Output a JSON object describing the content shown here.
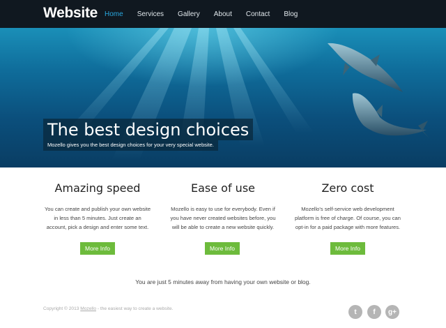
{
  "header": {
    "logo": "Website",
    "nav": [
      {
        "label": "Home",
        "active": true
      },
      {
        "label": "Services"
      },
      {
        "label": "Gallery"
      },
      {
        "label": "About"
      },
      {
        "label": "Contact"
      },
      {
        "label": "Blog"
      }
    ]
  },
  "hero": {
    "title": "The best design choices",
    "subtitle": "Mozello gives you the best design choices for your very special website."
  },
  "features": [
    {
      "title": "Amazing speed",
      "text": "You can create and publish your own website in less than 5 minutes. Just create an account, pick a design and enter some text.",
      "button": "More Info"
    },
    {
      "title": "Ease of use",
      "text": "Mozello is easy to use for everybody. Even if you have never created websites before, you will be able to create a new website quickly.",
      "button": "More Info"
    },
    {
      "title": "Zero cost",
      "text": "Mozello's self-service web development platform is free of charge. Of course, you can opt-in for a paid package with more features.",
      "button": "More Info"
    }
  ],
  "tagline": "You are just 5 minutes away from having your own website or blog.",
  "footer": {
    "copyright": "Copyright © 2013",
    "link": "Mozello",
    "suffix": " - the easiest way to create a website."
  },
  "social": [
    {
      "name": "twitter-icon",
      "glyph": "t"
    },
    {
      "name": "facebook-icon",
      "glyph": "f"
    },
    {
      "name": "google-plus-icon",
      "glyph": "g+"
    }
  ],
  "colors": {
    "header_bg": "#101820",
    "nav_active": "#29a8e0",
    "button_green": "#6dbb3c",
    "hero_blue": "#0f6d9b"
  }
}
